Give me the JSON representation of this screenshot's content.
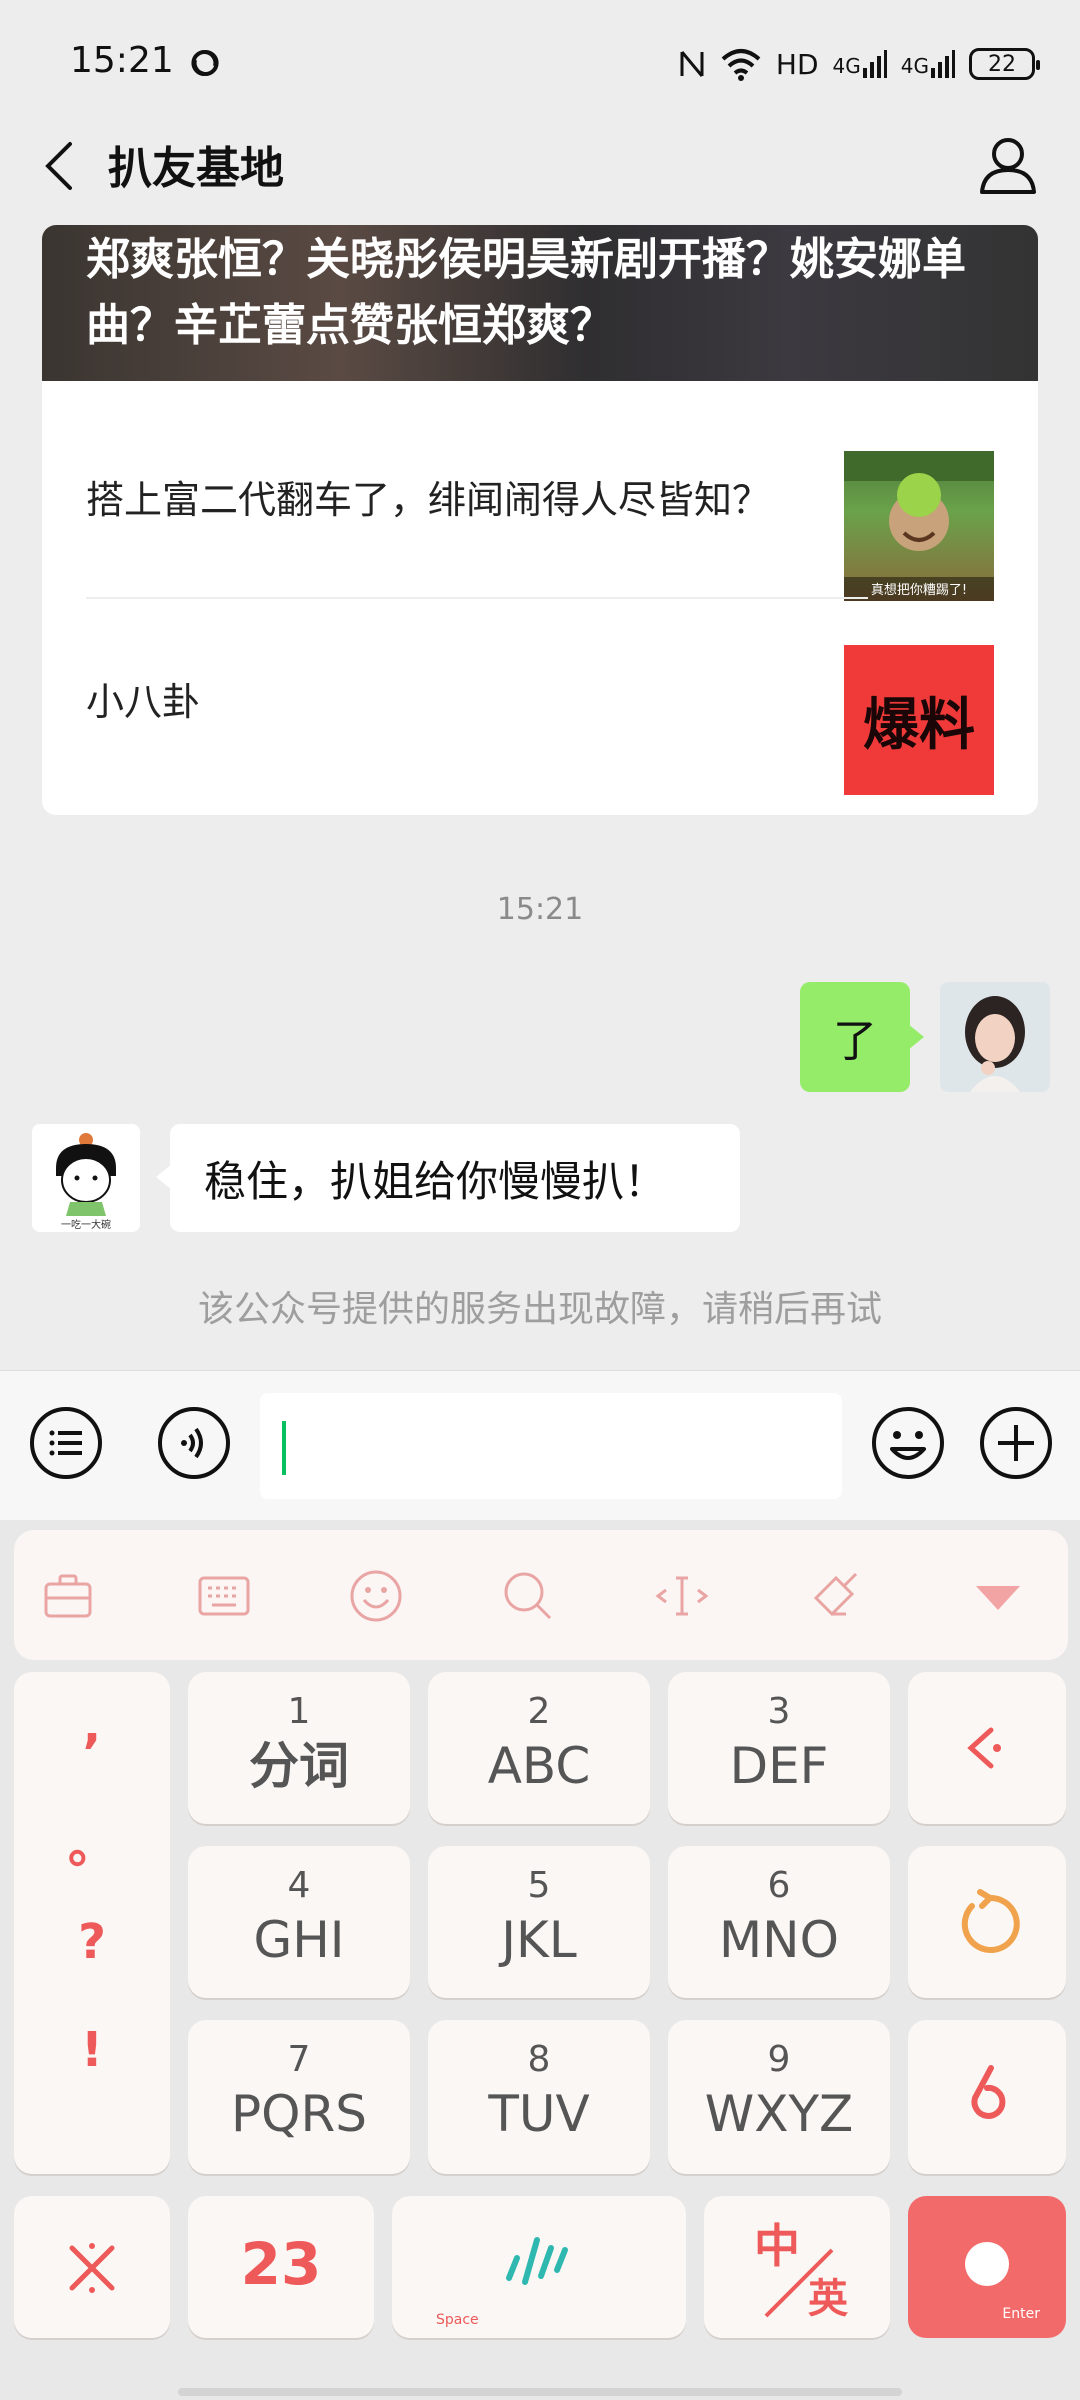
{
  "status_bar": {
    "time": "15:21",
    "hd": "HD",
    "net1": "4G",
    "net2": "4G",
    "battery": "22"
  },
  "nav": {
    "title": "扒友基地"
  },
  "article": {
    "hero_title": "郑爽张恒？关晓彤侯明昊新剧开播？姚安娜单曲？辛芷蕾点赞张恒郑爽？",
    "items": [
      {
        "title": "搭上富二代翻车了，绯闻闹得人尽皆知？",
        "thumb_caption": "真想把你糟踢了!"
      },
      {
        "title": "小八卦",
        "thumb_text": "爆料"
      }
    ]
  },
  "chat": {
    "timestamp": "15:21",
    "outgoing": "了",
    "incoming": "稳住，扒姐给你慢慢扒！",
    "bot_avatar_caption": "一吃一大碗",
    "system": "该公众号提供的服务出现故障，请稍后再试"
  },
  "keyboard": {
    "punct": [
      ",",
      "。",
      "?",
      "!"
    ],
    "keys": [
      {
        "num": "1",
        "letters": "分词"
      },
      {
        "num": "2",
        "letters": "ABC"
      },
      {
        "num": "3",
        "letters": "DEF"
      },
      {
        "num": "4",
        "letters": "GHI"
      },
      {
        "num": "5",
        "letters": "JKL"
      },
      {
        "num": "6",
        "letters": "MNO"
      },
      {
        "num": "7",
        "letters": "PQRS"
      },
      {
        "num": "8",
        "letters": "TUV"
      },
      {
        "num": "9",
        "letters": "WXYZ"
      }
    ],
    "num_switch": "23",
    "space_label": "Space",
    "lang_zh": "中",
    "lang_en": "英",
    "enter_label": "Enter"
  },
  "colors": {
    "accent_red": "#ee5a5a",
    "bubble_green": "#95ec69",
    "caret": "#07c160"
  }
}
